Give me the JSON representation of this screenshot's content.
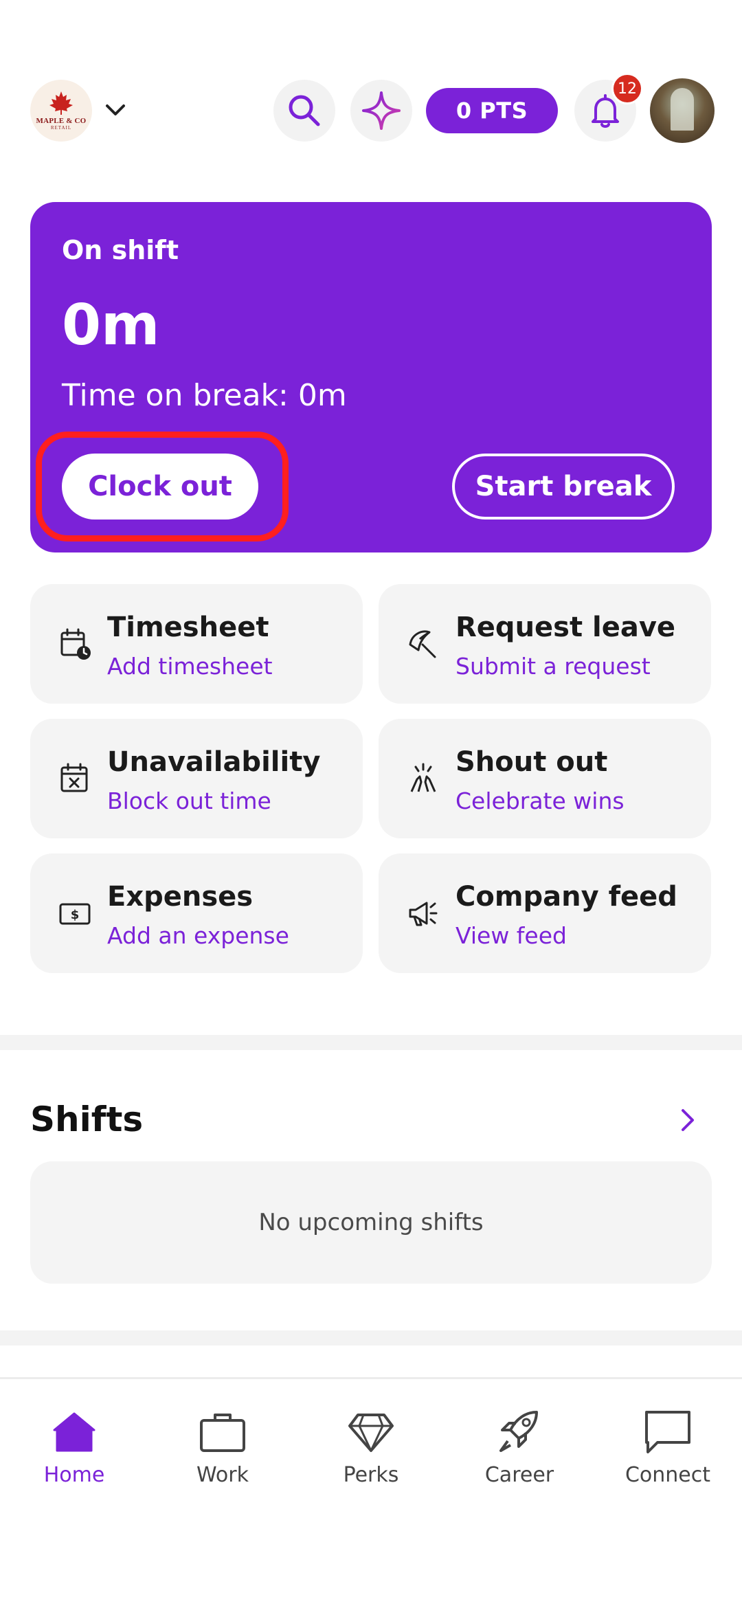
{
  "header": {
    "logo_text": "MAPLE & CO",
    "logo_subtext": "RETAIL",
    "points_label": "0 PTS",
    "notification_count": "12"
  },
  "shift_card": {
    "status": "On shift",
    "duration": "0m",
    "break_time": "Time on break: 0m",
    "clock_out_label": "Clock out",
    "start_break_label": "Start break"
  },
  "tiles": [
    {
      "title": "Timesheet",
      "subtitle": "Add timesheet",
      "icon": "calendar-clock-icon"
    },
    {
      "title": "Request leave",
      "subtitle": "Submit a request",
      "icon": "umbrella-icon"
    },
    {
      "title": "Unavailability",
      "subtitle": "Block out time",
      "icon": "calendar-x-icon"
    },
    {
      "title": "Shout out",
      "subtitle": "Celebrate wins",
      "icon": "clapping-hands-icon"
    },
    {
      "title": "Expenses",
      "subtitle": "Add an expense",
      "icon": "dollar-bill-icon"
    },
    {
      "title": "Company feed",
      "subtitle": "View feed",
      "icon": "megaphone-icon"
    }
  ],
  "shifts": {
    "title": "Shifts",
    "empty_text": "No upcoming shifts"
  },
  "bottom_nav": [
    {
      "label": "Home",
      "icon": "home-icon",
      "active": true
    },
    {
      "label": "Work",
      "icon": "briefcase-icon",
      "active": false
    },
    {
      "label": "Perks",
      "icon": "diamond-icon",
      "active": false
    },
    {
      "label": "Career",
      "icon": "rocket-icon",
      "active": false
    },
    {
      "label": "Connect",
      "icon": "chat-bubble-icon",
      "active": false
    }
  ],
  "colors": {
    "accent": "#7b22d8",
    "badge": "#d62b1f",
    "highlight_ring": "#ff1f1f",
    "tile_bg": "#f4f4f4"
  }
}
